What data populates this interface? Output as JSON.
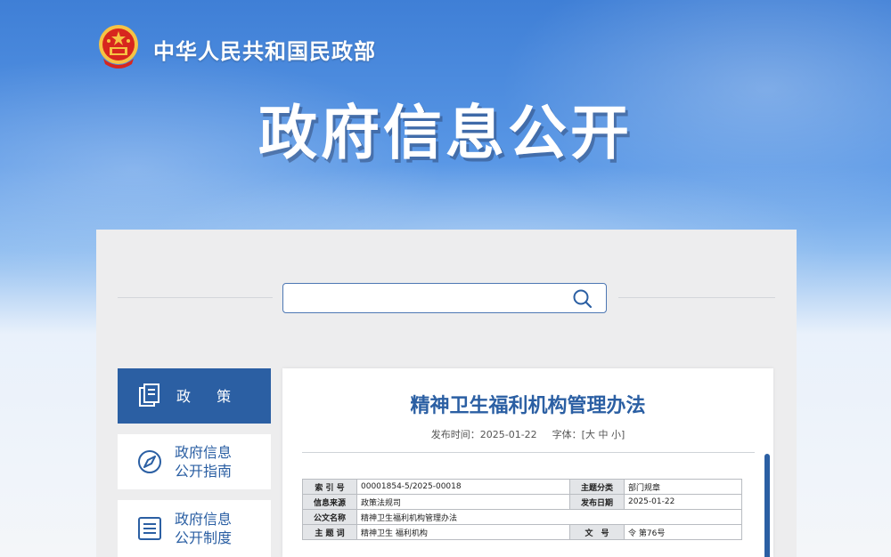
{
  "header": {
    "ministry_name": "中华人民共和国民政部",
    "title": "政府信息公开"
  },
  "search": {
    "value": "",
    "placeholder": ""
  },
  "sidebar": {
    "items": [
      {
        "label": "政 策",
        "icon": "document-icon",
        "active": true
      },
      {
        "label_line1": "政府信息",
        "label_line2": "公开指南",
        "icon": "compass-icon"
      },
      {
        "label_line1": "政府信息",
        "label_line2": "公开制度",
        "icon": "list-icon"
      }
    ]
  },
  "document": {
    "title": "精神卫生福利机构管理办法",
    "publish_label": "发布时间：",
    "publish_date": "2025-01-22",
    "font_label": "字体：",
    "font_open": "[",
    "font_large": "大",
    "font_medium": "中",
    "font_small": "小",
    "font_close": "]",
    "info_rows": [
      {
        "k1": "索 引 号",
        "v1": "00001854-5/2025-00018",
        "k2": "主题分类",
        "v2": "部门规章"
      },
      {
        "k1": "信息来源",
        "v1": "政策法规司",
        "k2": "发布日期",
        "v2": "2025-01-22"
      },
      {
        "k1": "公文名称",
        "v1": "精神卫生福利机构管理办法",
        "k2": "",
        "v2": ""
      },
      {
        "k1": "主 题 词",
        "v1": "精神卫生 福利机构",
        "k2": "文　号",
        "v2": "令 第76号"
      }
    ]
  },
  "colors": {
    "primary": "#2b5fa3",
    "emblem_red": "#d7261e",
    "emblem_gold": "#f6c343"
  }
}
